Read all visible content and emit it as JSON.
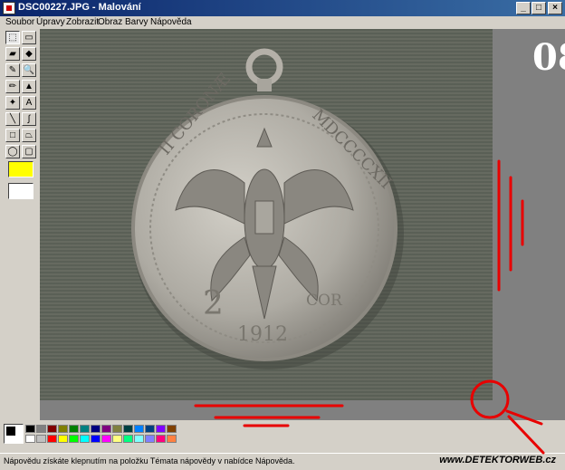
{
  "window": {
    "title": "DSC00227.JPG - Malování",
    "buttons": {
      "minimize": "_",
      "maximize": "□",
      "close": "×"
    }
  },
  "menu": {
    "items": [
      "Soubor",
      "Úpravy",
      "Zobrazit",
      "Obraz",
      "Barvy",
      "Nápověda"
    ]
  },
  "tools": [
    {
      "icon": "free-select-icon",
      "glyph": "⬚"
    },
    {
      "icon": "rect-select-icon",
      "glyph": "▭"
    },
    {
      "icon": "eraser-icon",
      "glyph": "▰"
    },
    {
      "icon": "fill-icon",
      "glyph": "◆"
    },
    {
      "icon": "pick-color-icon",
      "glyph": "✎"
    },
    {
      "icon": "magnifier-icon",
      "glyph": "🔍"
    },
    {
      "icon": "pencil-icon",
      "glyph": "✏"
    },
    {
      "icon": "brush-icon",
      "glyph": "▲"
    },
    {
      "icon": "airbrush-icon",
      "glyph": "✦"
    },
    {
      "icon": "text-icon",
      "glyph": "A"
    },
    {
      "icon": "line-icon",
      "glyph": "╲"
    },
    {
      "icon": "curve-icon",
      "glyph": "∫"
    },
    {
      "icon": "rectangle-icon",
      "glyph": "□"
    },
    {
      "icon": "polygon-icon",
      "glyph": "⏢"
    },
    {
      "icon": "ellipse-icon",
      "glyph": "◯"
    },
    {
      "icon": "rounded-rect-icon",
      "glyph": "▢"
    }
  ],
  "photo_label": "08",
  "coin": {
    "left_legend": "II CORONÆ",
    "right_legend": "MDCCCCXII",
    "denomination": "2",
    "currency": "COR",
    "year": "1912"
  },
  "colors": {
    "accent_red": "#e80000",
    "coin_silver": "#b9b6ae",
    "canvas_gray": "#808080",
    "title_blue": "#0a246a"
  },
  "palette": {
    "top": [
      "#000000",
      "#808080",
      "#800000",
      "#808000",
      "#008000",
      "#008080",
      "#000080",
      "#800080",
      "#808040",
      "#004040",
      "#0080ff",
      "#004080",
      "#8000ff",
      "#804000"
    ],
    "bottom": [
      "#ffffff",
      "#c0c0c0",
      "#ff0000",
      "#ffff00",
      "#00ff00",
      "#00ffff",
      "#0000ff",
      "#ff00ff",
      "#ffff80",
      "#00ff80",
      "#80ffff",
      "#8080ff",
      "#ff0080",
      "#ff8040"
    ]
  },
  "status": {
    "text": "Nápovědu získáte klepnutím na položku Témata nápovědy v nabídce Nápověda.",
    "watermark": "www.DETEKTORWEB.cz"
  }
}
